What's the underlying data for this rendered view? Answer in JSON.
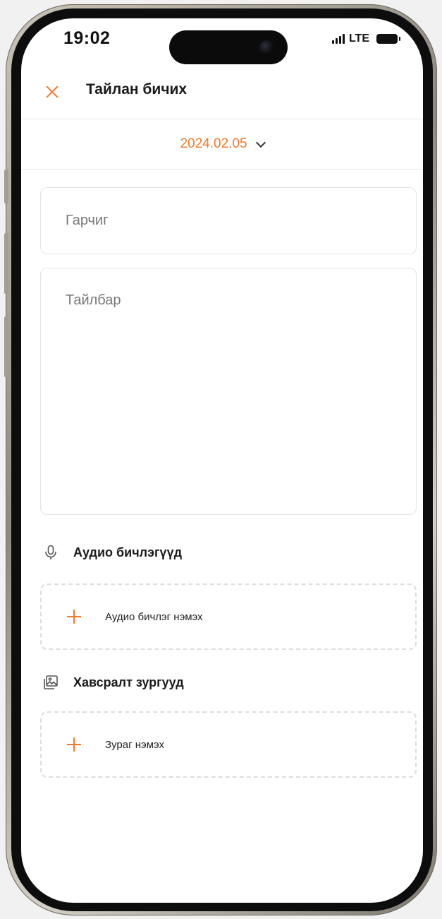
{
  "status_bar": {
    "time": "19:02",
    "network": "LTE"
  },
  "header": {
    "title": "Тайлан бичих",
    "close_icon": "close-icon"
  },
  "date_picker": {
    "value": "2024.02.05",
    "icon": "chevron-down-icon"
  },
  "form": {
    "title_placeholder": "Гарчиг",
    "description_placeholder": "Тайлбар"
  },
  "audio_section": {
    "heading": "Аудио бичлэгүүд",
    "icon": "mic-icon",
    "add_label": "Аудио бичлэг нэмэх"
  },
  "image_section": {
    "heading": "Хавсралт зургууд",
    "icon": "gallery-icon",
    "add_label": "Зураг нэмэх"
  },
  "colors": {
    "accent": "#f07a2c",
    "text": "#1a1a1a",
    "border": "#e3e3e3"
  }
}
